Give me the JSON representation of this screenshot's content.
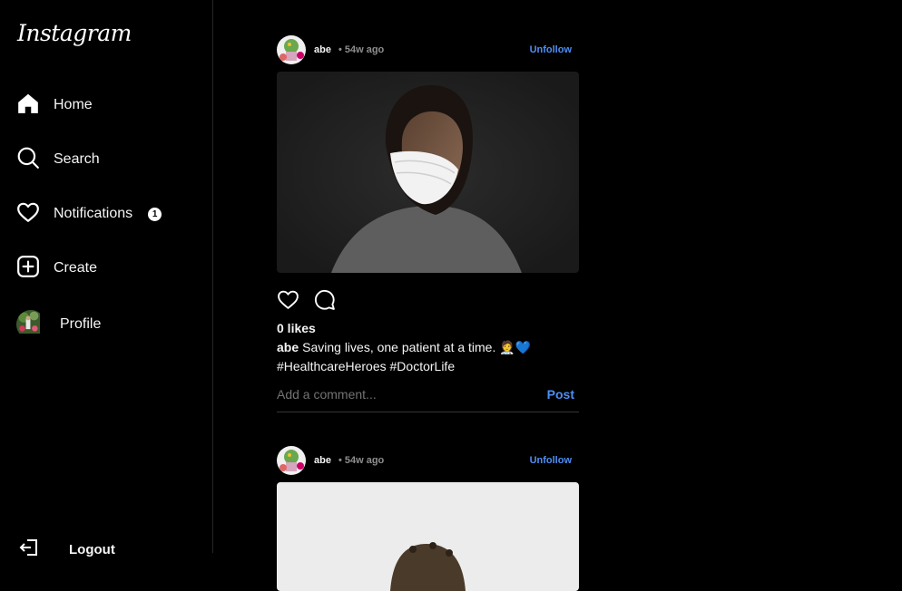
{
  "app": {
    "logo": "Instagram"
  },
  "sidebar": {
    "items": [
      {
        "label": "Home",
        "icon": "home-icon"
      },
      {
        "label": "Search",
        "icon": "search-icon"
      },
      {
        "label": "Notifications",
        "icon": "heart-icon",
        "badge": "1"
      },
      {
        "label": "Create",
        "icon": "plus-square-icon"
      },
      {
        "label": "Profile",
        "icon": "avatar"
      }
    ],
    "logout": {
      "label": "Logout",
      "icon": "logout-icon"
    }
  },
  "feed": {
    "posts": [
      {
        "username": "abe",
        "time": "• 54w ago",
        "follow_label": "Unfollow",
        "likes": "0 likes",
        "caption_user": "abe",
        "caption_text": "Saving lives, one patient at a time. 🧑‍⚕️💙 #HealthcareHeroes #DoctorLife",
        "comment_placeholder": "Add a comment...",
        "post_label": "Post"
      },
      {
        "username": "abe",
        "time": "• 54w ago",
        "follow_label": "Unfollow"
      }
    ]
  },
  "colors": {
    "background": "#000000",
    "accent": "#4d8ef5",
    "muted": "#8e8e8e",
    "border": "#262626"
  }
}
